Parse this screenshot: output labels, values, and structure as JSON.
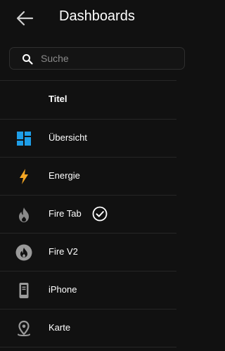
{
  "header": {
    "title": "Dashboards",
    "back_icon": "arrow-left-icon"
  },
  "search": {
    "placeholder": "Suche",
    "icon": "search-icon"
  },
  "table": {
    "column_title": "Titel",
    "rows": [
      {
        "label": "Übersicht",
        "icon": "dashboard-grid-icon",
        "icon_color": "#1e9ee8"
      },
      {
        "label": "Energie",
        "icon": "lightning-icon",
        "icon_color": "#f5a623"
      },
      {
        "label": "Fire Tab",
        "icon": "fire-icon",
        "icon_color": "#8a8a8a",
        "badge": "check-circle-icon"
      },
      {
        "label": "Fire V2",
        "icon": "fire-circle-icon",
        "icon_color": "#9a9a9a"
      },
      {
        "label": "iPhone",
        "icon": "cellphone-icon",
        "icon_color": "#9a9a9a"
      },
      {
        "label": "Karte",
        "icon": "map-marker-icon",
        "icon_color": "#9a9a9a"
      }
    ]
  },
  "colors": {
    "background": "#111111",
    "text": "#ffffff",
    "divider": "#262626"
  }
}
